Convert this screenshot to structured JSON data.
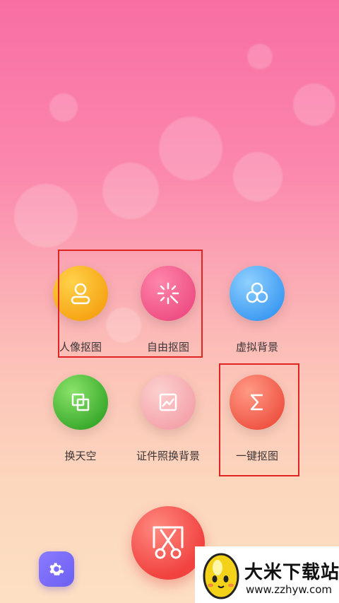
{
  "buttons": [
    {
      "name": "portrait-cutout-button",
      "label": "人像抠图",
      "icon": "person-icon",
      "color": "#f8b21e"
    },
    {
      "name": "free-cutout-button",
      "label": "自由抠图",
      "icon": "magic-wand-icon",
      "color": "#f45d8c"
    },
    {
      "name": "virtual-background-button",
      "label": "虚拟背景",
      "icon": "circles-icon",
      "color": "#4ca7f5"
    },
    {
      "name": "replace-sky-button",
      "label": "换天空",
      "icon": "layers-icon",
      "color": "#4fbf3a"
    },
    {
      "name": "id-photo-background-button",
      "label": "证件照换背景",
      "icon": "photo-frame-icon",
      "color": "#f7b1b6"
    },
    {
      "name": "one-click-cutout-button",
      "label": "一键抠图",
      "icon": "sigma-icon",
      "color": "#f2574b"
    }
  ],
  "watermark": {
    "title": "大米下载站",
    "url": "www.zzhyw.com"
  }
}
